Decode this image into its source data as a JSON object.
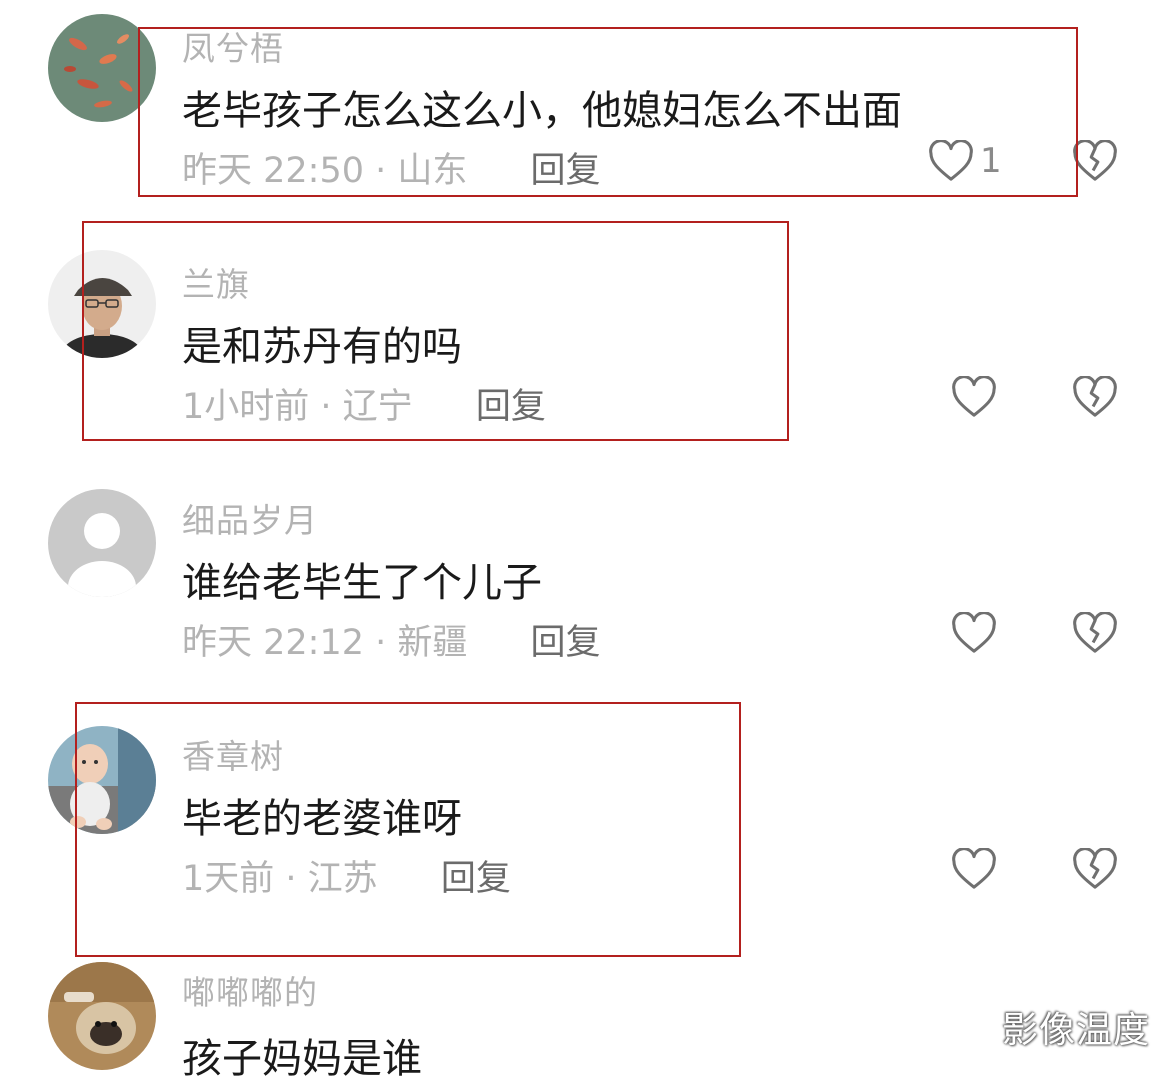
{
  "comments": [
    {
      "username": "凤兮梧",
      "text": "老毕孩子怎么这么小，他媳妇怎么不出面",
      "time": "昨天 22:50",
      "location": "山东",
      "reply": "回复",
      "likes": "1"
    },
    {
      "username": "兰旗",
      "text": "是和苏丹有的吗",
      "time": "1小时前",
      "location": "辽宁",
      "reply": "回复",
      "likes": ""
    },
    {
      "username": "细品岁月",
      "text": "谁给老毕生了个儿子",
      "time": "昨天 22:12",
      "location": "新疆",
      "reply": "回复",
      "likes": ""
    },
    {
      "username": "香章树",
      "text": "毕老的老婆谁呀",
      "time": "1天前",
      "location": "江苏",
      "reply": "回复",
      "likes": ""
    },
    {
      "username": "嘟嘟嘟的",
      "text": "孩子妈妈是谁",
      "time": "",
      "location": "",
      "reply": "",
      "likes": ""
    }
  ],
  "watermark": "影像温度",
  "colors": {
    "highlight_box": "#b3201e",
    "meta_text": "#b3b3b3",
    "reply_text": "#6b6b6b"
  }
}
